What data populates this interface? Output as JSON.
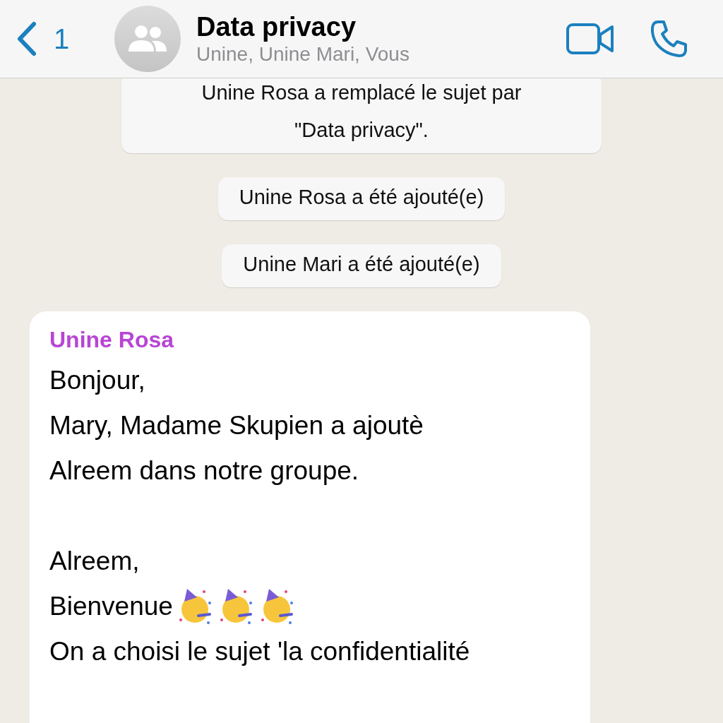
{
  "header": {
    "back_count": "1",
    "title": "Data privacy",
    "subtitle": "Unine, Unine Mari, Vous"
  },
  "system_messages": [
    {
      "text": "Unine Rosa  a remplacé le sujet par \"Data privacy\"."
    },
    {
      "text": "Unine Rosa  a été ajouté(e)"
    },
    {
      "text": "Unine Mari a été ajouté(e)"
    }
  ],
  "message": {
    "sender": "Unine Rosa",
    "lines": [
      {
        "kind": "text",
        "text": "Bonjour,"
      },
      {
        "kind": "text",
        "text": "Mary, Madame Skupien a ajoutè"
      },
      {
        "kind": "text",
        "text": "Alreem dans notre groupe."
      },
      {
        "kind": "blank"
      },
      {
        "kind": "text",
        "text": "Alreem,"
      },
      {
        "kind": "party",
        "text": "Bienvenue"
      },
      {
        "kind": "text",
        "text": "On a choisi le sujet 'la confidentialité"
      }
    ]
  }
}
